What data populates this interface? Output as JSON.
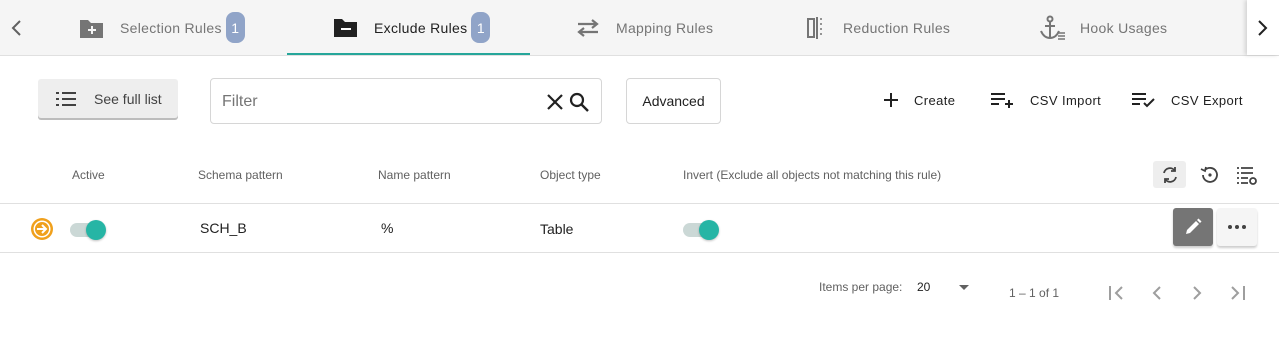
{
  "tabs": [
    {
      "label": "Selection Rules",
      "icon": "folder-plus-icon",
      "badge": "1"
    },
    {
      "label": "Exclude Rules",
      "icon": "folder-minus-icon",
      "badge": "1"
    },
    {
      "label": "Mapping Rules",
      "icon": "swap-arrows-icon"
    },
    {
      "label": "Reduction Rules",
      "icon": "reduce-columns-icon"
    },
    {
      "label": "Hook Usages",
      "icon": "anchor-list-icon"
    }
  ],
  "active_tab": "Exclude Rules",
  "accent_color": "#26a69a",
  "toolbar": {
    "see_full_list": "See full list",
    "filter_placeholder": "Filter",
    "filter_value": "",
    "advanced": "Advanced",
    "create": "Create",
    "csv_import": "CSV Import",
    "csv_export": "CSV Export"
  },
  "table": {
    "headers": {
      "active": "Active",
      "schema_pattern": "Schema pattern",
      "name_pattern": "Name pattern",
      "object_type": "Object type",
      "invert": "Invert (Exclude all objects not matching this rule)"
    },
    "rows": [
      {
        "active": true,
        "schema_pattern": "SCH_B",
        "name_pattern": "%",
        "object_type": "Table",
        "invert": true
      }
    ]
  },
  "paginator": {
    "items_per_page_label": "Items per page:",
    "items_per_page": "20",
    "range": "1 – 1 of 1"
  }
}
